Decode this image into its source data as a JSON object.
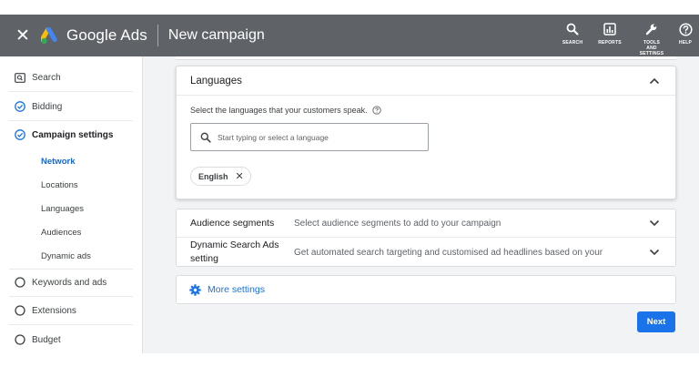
{
  "header": {
    "brand": "Google Ads",
    "page_title": "New campaign",
    "actions": [
      {
        "label": "SEARCH",
        "icon": "search-icon"
      },
      {
        "label": "REPORTS",
        "icon": "reports-icon"
      },
      {
        "label": "TOOLS AND SETTINGS",
        "icon": "wrench-icon"
      },
      {
        "label": "HELP",
        "icon": "help-icon"
      }
    ]
  },
  "sidebar": {
    "items": [
      {
        "label": "Search",
        "icon": "search-campaign-icon"
      },
      {
        "label": "Bidding",
        "icon": "check-circle-icon"
      },
      {
        "label": "Campaign settings",
        "icon": "check-circle-icon"
      }
    ],
    "subitems": [
      {
        "label": "Network"
      },
      {
        "label": "Locations"
      },
      {
        "label": "Languages"
      },
      {
        "label": "Audiences"
      },
      {
        "label": "Dynamic ads"
      }
    ],
    "steps": [
      {
        "label": "Keywords and ads",
        "icon": "empty-circle-icon"
      },
      {
        "label": "Extensions",
        "icon": "empty-circle-icon"
      },
      {
        "label": "Budget",
        "icon": "empty-circle-icon"
      }
    ]
  },
  "languages": {
    "title": "Languages",
    "description": "Select the languages that your customers speak.",
    "placeholder": "Start typing or select a language",
    "selected": [
      "English"
    ]
  },
  "audience": {
    "title": "Audience segments",
    "description": "Select audience segments to add to your campaign"
  },
  "dsa": {
    "title": "Dynamic Search Ads setting",
    "description": "Get automated search targeting and customised ad headlines based on your"
  },
  "more_settings": "More settings",
  "next_label": "Next",
  "colors": {
    "header": "#5f6368",
    "accent": "#1a73e8",
    "active_nav": "#1967d2"
  }
}
